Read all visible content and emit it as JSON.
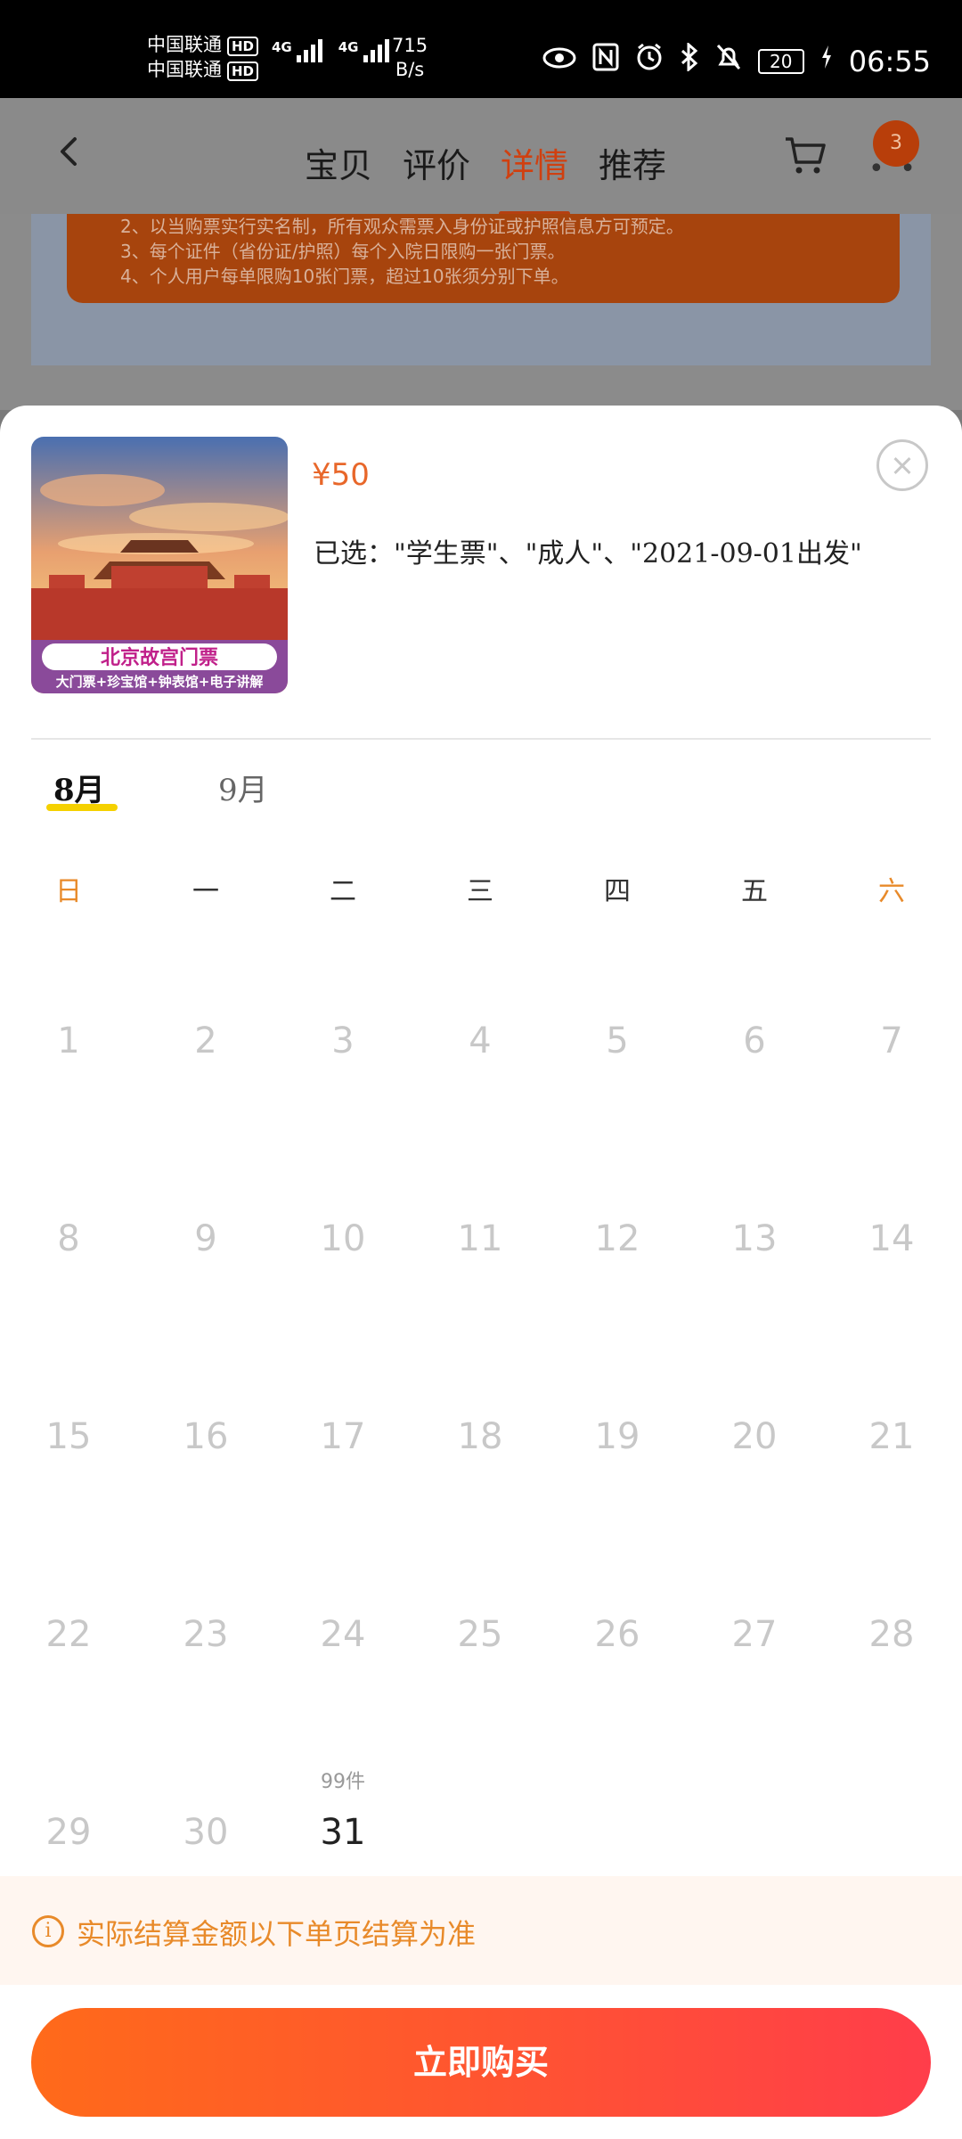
{
  "status_bar": {
    "carrier1": "中国联通",
    "carrier2": "中国联通",
    "hd": "HD",
    "network1": "4G",
    "network2": "4G",
    "speed_value": "715",
    "speed_unit": "B/s",
    "battery": "20",
    "time": "06:55"
  },
  "header": {
    "tabs": [
      "宝贝",
      "评价",
      "详情",
      "推荐"
    ],
    "active_tab": "详情",
    "cart_count": "3"
  },
  "background_notice": {
    "lines": [
      "2、以当购票实行实名制，所有观众需票入身份证或护照信息方可预定。",
      "3、每个证件（省份证/护照）每个入院日限购一张门票。",
      "4、个人用户每单限购10张门票，超过10张须分别下单。"
    ]
  },
  "product": {
    "price": "¥50",
    "selected_text": "已选：\"学生票\"、\"成人\"、\"2021-09-01出发\"",
    "image_title": "北京故宫门票",
    "image_subtitle": "大门票+珍宝馆+钟表馆+电子讲解"
  },
  "calendar": {
    "months": [
      "8月",
      "9月"
    ],
    "active_month": "8月",
    "weekdays": [
      "日",
      "一",
      "二",
      "三",
      "四",
      "五",
      "六"
    ],
    "days": [
      "1",
      "2",
      "3",
      "4",
      "5",
      "6",
      "7",
      "8",
      "9",
      "10",
      "11",
      "12",
      "13",
      "14",
      "15",
      "16",
      "17",
      "18",
      "19",
      "20",
      "21",
      "22",
      "23",
      "24",
      "25",
      "26",
      "27",
      "28",
      "29",
      "30",
      "31"
    ],
    "available_day": "31",
    "available_stock": "99件"
  },
  "tip": {
    "icon": "info-icon",
    "text": "实际结算金额以下单页结算为准"
  },
  "buy_button": {
    "label": "立即购买"
  },
  "colors": {
    "accent_orange": "#e88a2a",
    "price": "#e8672a",
    "button_start": "#ff6a1a",
    "button_end": "#ff3d4a",
    "month_underline": "#f5d100"
  }
}
